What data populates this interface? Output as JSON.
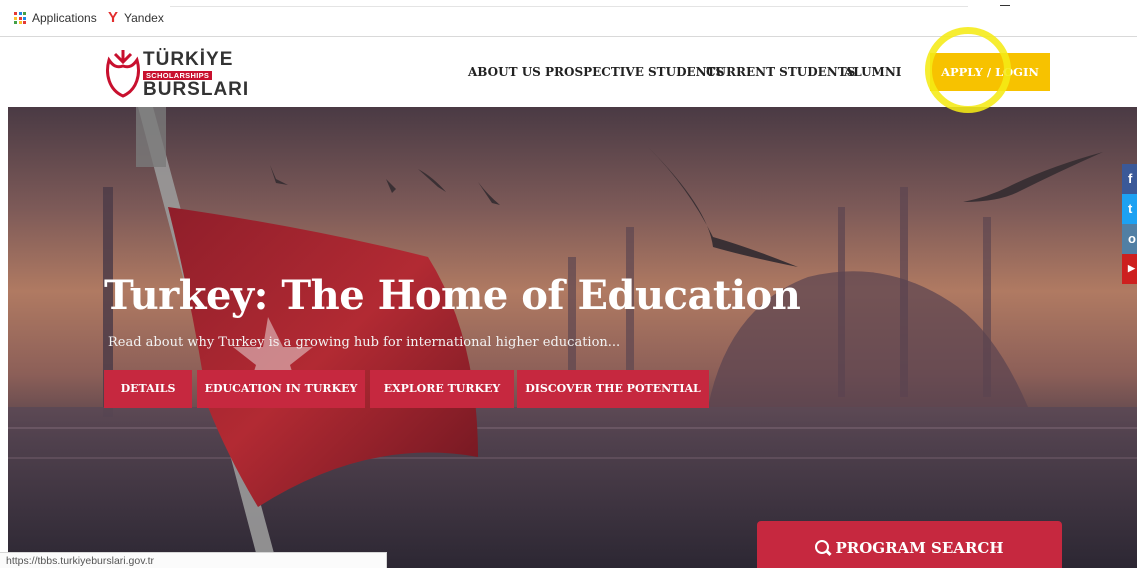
{
  "bookmarks": {
    "items": [
      {
        "label": "Applications",
        "icon": "apps-grid-icon"
      },
      {
        "label": "Yandex",
        "icon": "yandex-icon"
      }
    ]
  },
  "header": {
    "logo": {
      "line1": "TÜRKİYE",
      "line2": "SCHOLARSHIPS",
      "line3": "BURSLARI"
    },
    "nav": [
      "ABOUT US",
      "PROSPECTIVE STUDENTS",
      "CURRENT STUDENTS",
      "ALUMNI"
    ],
    "apply_label": "APPLY / LOGIN"
  },
  "hero": {
    "title": "Turkey: The Home of Education",
    "subtitle": "Read about why Turkey is a growing hub for international higher education...",
    "buttons": [
      "DETAILS",
      "EDUCATION IN TURKEY",
      "EXPLORE TURKEY",
      "DISCOVER THE POTENTIAL"
    ]
  },
  "social": [
    {
      "icon": "facebook-icon",
      "glyph": "f",
      "color": "#3b5998"
    },
    {
      "icon": "twitter-icon",
      "glyph": "t",
      "color": "#1da1f2"
    },
    {
      "icon": "instagram-icon",
      "glyph": "o",
      "color": "#517fa4"
    },
    {
      "icon": "youtube-icon",
      "glyph": "▶",
      "color": "#cd201f"
    }
  ],
  "program_search": {
    "label": "PROGRAM SEARCH"
  },
  "status": {
    "url": "https://tbbs.turkiyeburslari.gov.tr"
  },
  "colors": {
    "brand_red": "#c6283f",
    "apply_yellow": "#f7c200",
    "highlight": "#f5eb14"
  }
}
